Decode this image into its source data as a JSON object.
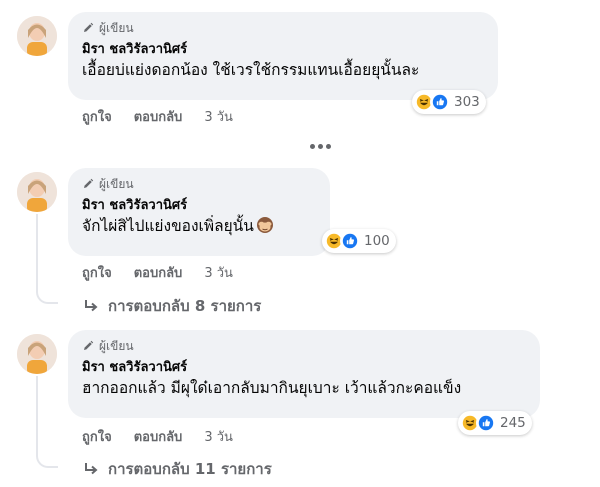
{
  "comments": [
    {
      "badge": "ผู้เขียน",
      "author": "มิรา ชลวิรัลวานิศร์",
      "text": "เอื้อยบ่แย่งดอกน้อง ใช้เวรใช้กรรมแทนเอื้อยยุนั้นละ",
      "reaction_count": "303",
      "actions": {
        "like": "ถูกใจ",
        "reply": "ตอบกลับ",
        "time": "3 วัน"
      }
    },
    {
      "badge": "ผู้เขียน",
      "author": "มิรา ชลวิรัลวานิศร์",
      "text": "จักไผ่สิไปแย่งของเพิ่ลยุนั้น",
      "reaction_count": "100",
      "actions": {
        "like": "ถูกใจ",
        "reply": "ตอบกลับ",
        "time": "3 วัน"
      },
      "replies": "การตอบกลับ 8 รายการ"
    },
    {
      "badge": "ผู้เขียน",
      "author": "มิรา ชลวิรัลวานิศร์",
      "text": "ฮากออกแล้ว มีผุใด๋เอากลับมากินยุเบาะ เว้าแล้วกะคอแข็ง",
      "reaction_count": "245",
      "actions": {
        "like": "ถูกใจ",
        "reply": "ตอบกลับ",
        "time": "3 วัน"
      },
      "replies": "การตอบกลับ 11 รายการ"
    }
  ],
  "colors": {
    "bubble": "#f0f2f5",
    "secondary_text": "#65676b",
    "like_blue": "#1877f2",
    "haha_yellow": "#f7b928"
  },
  "icons": {
    "badge": "pen-icon",
    "reactions": [
      "haha-icon",
      "like-icon"
    ],
    "inline_emoji": "see-no-evil-monkey-icon",
    "replies": "reply-arrow-icon",
    "more": "more-dots-icon"
  }
}
